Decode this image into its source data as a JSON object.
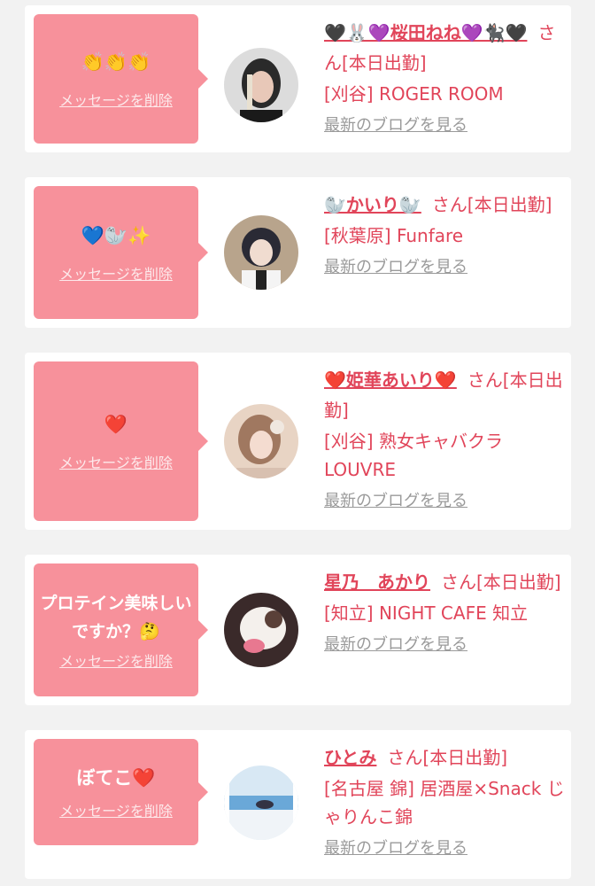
{
  "cards": [
    {
      "message": "👏👏👏",
      "delete_label": "メッセージを削除",
      "name": "🖤🐰💜桜田ねね💜🐈‍⬛🖤",
      "suffix": "さん[本日出勤]",
      "shop": "[刈谷] ROGER ROOM",
      "blog_label": "最新のブログを見る"
    },
    {
      "message": "💙🦭✨",
      "delete_label": "メッセージを削除",
      "name": "🦭かいり🦭",
      "suffix": "さん[本日出勤]",
      "shop": "[秋葉原] Funfare",
      "blog_label": "最新のブログを見る"
    },
    {
      "message": "❤️",
      "delete_label": "メッセージを削除",
      "name": "❤️姫華あいり❤️",
      "suffix": "さん[本日出勤]",
      "shop": "[刈谷] 熟女キャバクラ LOUVRE",
      "blog_label": "最新のブログを見る"
    },
    {
      "message": "プロテイン美味しいですか？🤔",
      "delete_label": "メッセージを削除",
      "name": "星乃　あかり",
      "suffix": "さん[本日出勤]",
      "shop": "[知立] NIGHT CAFE 知立",
      "blog_label": "最新のブログを見る"
    },
    {
      "message": "ぼてこ❤️",
      "delete_label": "メッセージを削除",
      "name": "ひとみ",
      "suffix": "さん[本日出勤]",
      "shop": "[名古屋 錦] 居酒屋×Snack じゃりんこ錦",
      "blog_label": "最新のブログを見る"
    }
  ],
  "colors": {
    "accent": "#e1455a",
    "bubble": "#f7919b",
    "muted": "#9a9a9a",
    "background": "#f2f2f2"
  }
}
